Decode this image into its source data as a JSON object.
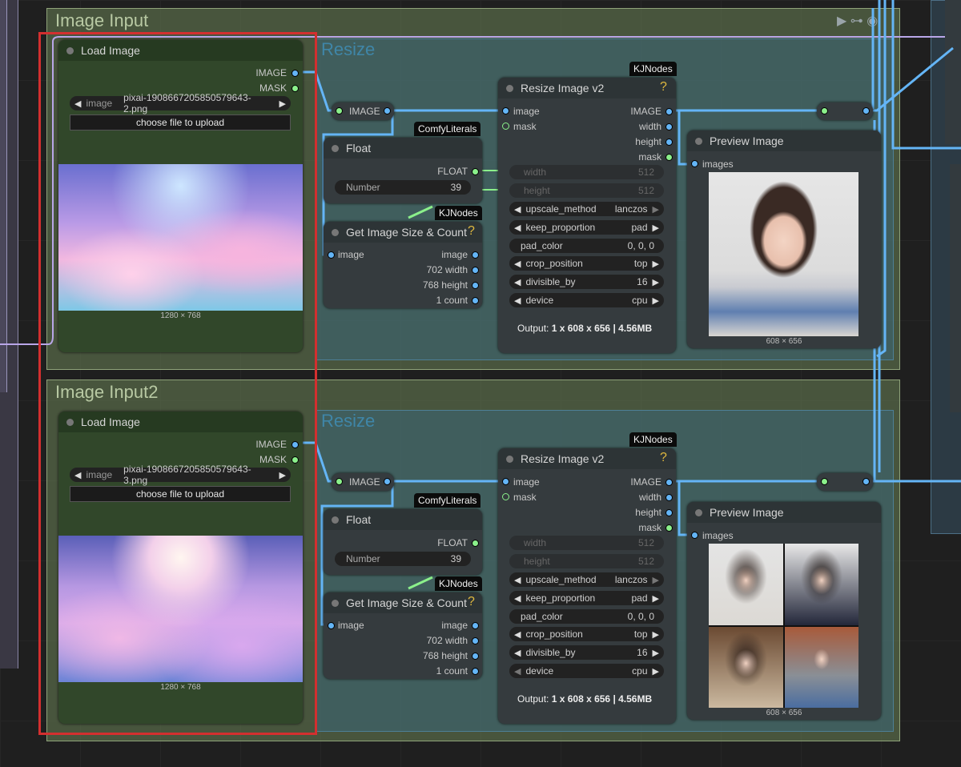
{
  "groups": [
    {
      "title": "Image Input",
      "sub_title": "Resize"
    },
    {
      "title": "Image Input2",
      "sub_title": "Resize"
    }
  ],
  "load_image": [
    {
      "title": "Load Image",
      "out_image": "IMAGE",
      "out_mask": "MASK",
      "combo_label": "image",
      "combo_value": "pixai-1908667205850579643-2.png",
      "upload_label": "choose file to upload",
      "size": "1280 × 768"
    },
    {
      "title": "Load Image",
      "out_image": "IMAGE",
      "out_mask": "MASK",
      "combo_label": "image",
      "combo_value": "pixai-1908667205850579643-3.png",
      "upload_label": "choose file to upload",
      "size": "1280 × 768"
    }
  ],
  "reroute_label": "IMAGE",
  "float_node": {
    "tag": "ComfyLiterals",
    "title": "Float",
    "out": "FLOAT",
    "number_label": "Number",
    "number_value": "39"
  },
  "size_node": {
    "tag": "KJNodes",
    "title": "Get Image Size & Count",
    "q": "?",
    "in": "image",
    "out_image": "image",
    "out_width": "702 width",
    "out_height": "768 height",
    "out_count": "1 count"
  },
  "resize_node": {
    "tag": "KJNodes",
    "title": "Resize Image v2",
    "q": "?",
    "in_image": "image",
    "in_mask": "mask",
    "out_image": "IMAGE",
    "out_width": "width",
    "out_height": "height",
    "out_mask": "mask",
    "width_label": "width",
    "width_value": "512",
    "height_label": "height",
    "height_value": "512",
    "upscale_label": "upscale_method",
    "upscale_value": "lanczos",
    "keep_label": "keep_proportion",
    "keep_value": "pad",
    "pad_label": "pad_color",
    "pad_value": "0, 0, 0",
    "crop_label": "crop_position",
    "crop_value": "top",
    "div_label": "divisible_by",
    "div_value": "16",
    "device_label": "device",
    "device_value": "cpu",
    "output_prefix": "Output: ",
    "output_value": "1 x 608 x 656 | 4.56MB"
  },
  "preview_node": {
    "title": "Preview Image",
    "in": "images",
    "size": "608 × 656"
  },
  "colors": {
    "link_blue": "#64b5f6",
    "link_green": "#8bf08b",
    "link_purple": "#b9a6e8",
    "highlight": "#d32f2f"
  }
}
